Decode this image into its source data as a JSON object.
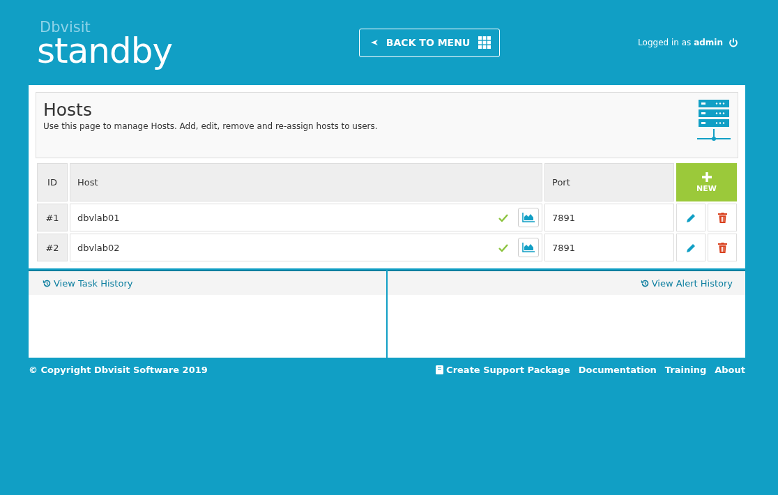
{
  "logo": {
    "brand": "Dbvisit",
    "product": "standby"
  },
  "back_button": "BACK TO MENU",
  "user": {
    "prefix": "Logged in as",
    "name": "admin"
  },
  "page": {
    "title": "Hosts",
    "description": "Use this page to manage Hosts. Add, edit, remove and re-assign hosts to users."
  },
  "table": {
    "columns": [
      "ID",
      "Host",
      "Port"
    ],
    "new_button": "NEW",
    "rows": [
      {
        "id": "#1",
        "host": "dbvlab01",
        "online": true,
        "port": "7891"
      },
      {
        "id": "#2",
        "host": "dbvlab02",
        "online": true,
        "port": "7891"
      }
    ]
  },
  "panels": [
    {
      "link": "View Task History",
      "kind": "task"
    },
    {
      "link": "View Alert History",
      "kind": "alert"
    }
  ],
  "footer": {
    "copyright": "© Copyright Dbvisit Software 2019",
    "links": [
      {
        "label": "Create Support Package",
        "kind": "icon"
      },
      {
        "label": "Documentation",
        "kind": "plain"
      },
      {
        "label": "Training",
        "kind": "plain"
      },
      {
        "label": "About",
        "kind": "plain"
      }
    ]
  }
}
